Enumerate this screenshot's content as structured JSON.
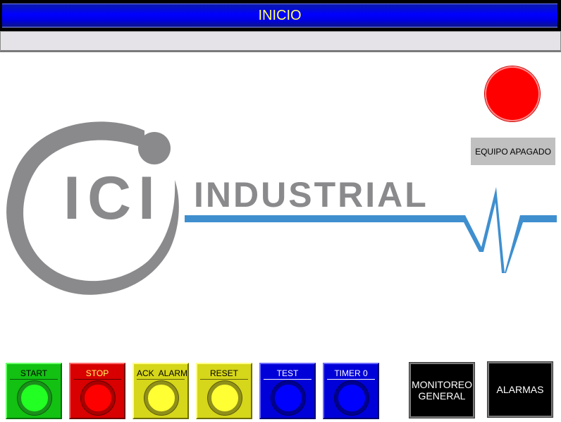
{
  "header": {
    "title": "INICIO"
  },
  "status": {
    "label": "EQUIPO APAGADO",
    "lamp_color": "#ff0000",
    "state": "off"
  },
  "logo": {
    "mark_text": "ICI",
    "brand_text": "INDUSTRIAL",
    "gray": "#8a8a8c",
    "blue": "#3f8fcf"
  },
  "controls": {
    "start_label": "START",
    "stop_label": "STOP",
    "ack_label": "ACK  ALARM",
    "reset_label": "RESET",
    "test_label": "TEST",
    "timer_label": "TIMER 0"
  },
  "navigation": {
    "monitoreo_label": "MONITOREO\nGENERAL",
    "alarmas_label": "ALARMAS"
  }
}
